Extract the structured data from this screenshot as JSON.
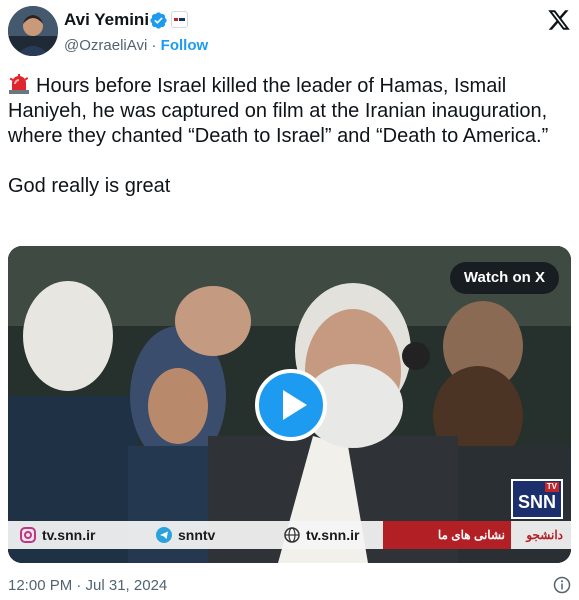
{
  "author": {
    "name": "Avi Yemini",
    "handle": "@OzraeliAvi",
    "separator": "·",
    "follow_label": "Follow"
  },
  "tweet": {
    "text": "Hours before Israel killed the leader of Hamas, Ismail Haniyeh, he was captured on film at the Iranian inauguration, where they chanted “Death to Israel” and “Death to America.”\n\nGod really is great",
    "emoji": "police-car-light-emoji"
  },
  "video": {
    "watch_label": "Watch on X",
    "channel_logo": "SNN",
    "channel_logo_tv": "TV",
    "bottom_bar": {
      "instagram": "tv.snn.ir",
      "telegram": "snntv",
      "web": "tv.snn.ir",
      "persian_text": "نشانی های ما",
      "persian_logo": "دانشجو"
    }
  },
  "meta": {
    "timestamp": "12:00 PM · Jul 31, 2024"
  },
  "colors": {
    "accent": "#1d9bf0",
    "text": "#0f1419",
    "secondary": "#536471"
  }
}
